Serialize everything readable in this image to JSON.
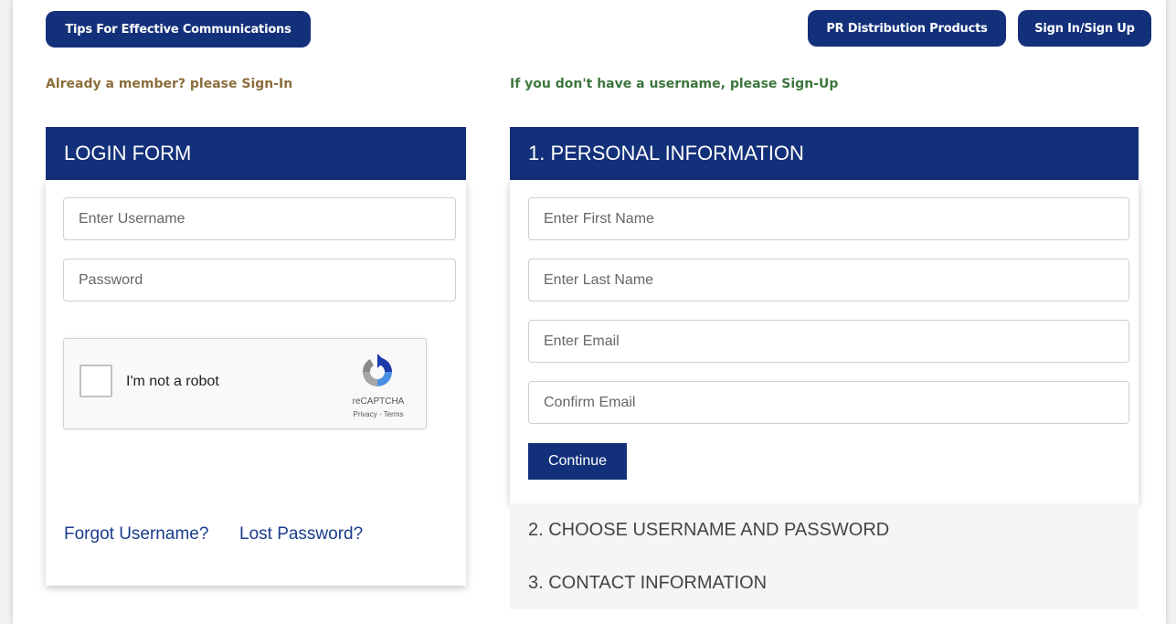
{
  "header": {
    "tips_label": "Tips For Effective Communications",
    "products_label": "PR Distribution Products",
    "signin_label": "Sign In/Sign Up"
  },
  "notes": {
    "member_note": "Already a member? please Sign-In",
    "signup_note": "If you don't have a username, please Sign-Up"
  },
  "login": {
    "title": "LOGIN FORM",
    "username_placeholder": "Enter Username",
    "password_placeholder": "Password",
    "captcha": {
      "label": "I'm not a robot",
      "brand": "reCAPTCHA",
      "links": "Privacy - Terms"
    },
    "forgot_username": "Forgot Username?",
    "lost_password": "Lost Password?"
  },
  "signup": {
    "title": "1. PERSONAL INFORMATION",
    "first_name_placeholder": "Enter First Name",
    "last_name_placeholder": "Enter Last Name",
    "email_placeholder": "Enter Email",
    "confirm_email_placeholder": "Confirm Email",
    "continue_label": "Continue",
    "step2": "2. CHOOSE USERNAME AND PASSWORD",
    "step3": "3. CONTACT INFORMATION"
  },
  "colors": {
    "brand_navy": "#13307a",
    "member_note": "#8a6d3b",
    "signup_note": "#3c763d",
    "link": "#1a3c8c"
  }
}
